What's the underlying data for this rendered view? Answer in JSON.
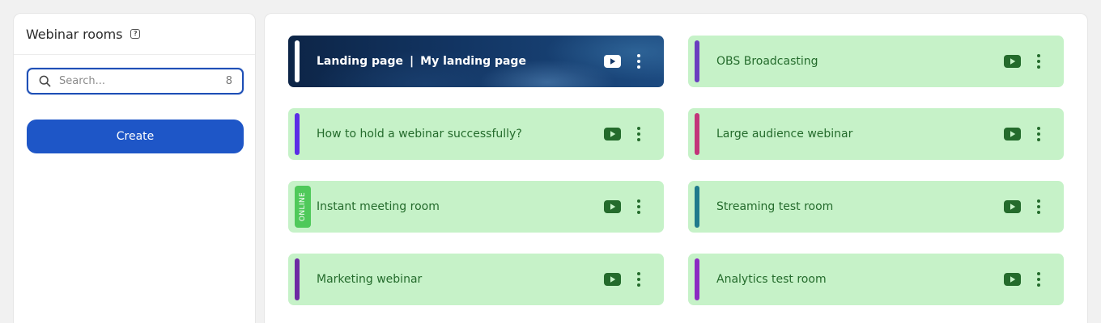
{
  "sidebar": {
    "title": "Webinar rooms",
    "help_glyph": "?",
    "search": {
      "placeholder": "Search...",
      "count": "8"
    },
    "create_label": "Create"
  },
  "rooms": [
    {
      "title_left": "Landing page",
      "separator": "|",
      "title_right": "My landing page",
      "style": "dark",
      "accent": "#ffffff"
    },
    {
      "title": "OBS Broadcasting",
      "accent": "#6a3dbf"
    },
    {
      "title": "How to hold a webinar successfully?",
      "accent": "#5b2ee6"
    },
    {
      "title": "Large audience webinar",
      "accent": "#c2357a"
    },
    {
      "title": "Instant meeting room",
      "badge": "ONLINE",
      "badge_color": "#4fc95a"
    },
    {
      "title": "Streaming test room",
      "accent": "#1f7a8c"
    },
    {
      "title": "Marketing webinar",
      "accent": "#6d2aa3"
    },
    {
      "title": "Analytics test room",
      "accent": "#8b2ac2"
    }
  ],
  "colors": {
    "room_bg": "#c6f2c8",
    "room_text": "#246b2c",
    "primary": "#1e56c7",
    "play_icon": "#246b2c"
  },
  "icons": {
    "help": "help-icon",
    "search": "search-icon",
    "play": "youtube-play-icon",
    "more": "more-vertical-icon"
  }
}
